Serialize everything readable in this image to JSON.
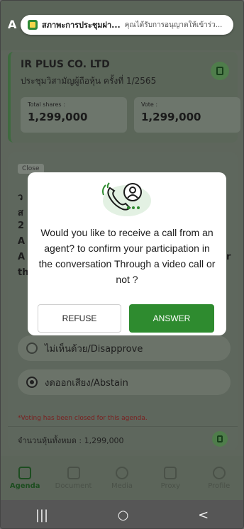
{
  "notification": {
    "title": "สภาพะการประชุมผ่า...",
    "message": "คุณได้รับการอนุญาตให้เข้าร่ว..."
  },
  "header": {
    "letter": "A"
  },
  "company": {
    "name": "IR PLUS CO. LTD",
    "meeting": "ประชุมวิสามัญผู้ถือหุ้น ครั้งที่ 1/2565",
    "total_shares_label": "Total shares :",
    "total_shares_value": "1,299,000",
    "vote_label": "Vote :",
    "vote_value": "1,299,000"
  },
  "agenda": {
    "status": "Close",
    "bg_lines": [
      "ว",
      "ส",
      "2",
      "A",
      "A",
      "th"
    ],
    "bg_right": "r",
    "options": [
      {
        "label": "ไม่เห็นด้วย/Disapprove",
        "selected": false
      },
      {
        "label": "งดออกเสียง/Abstain",
        "selected": true
      }
    ],
    "closed_note": "*Voting has been closed for this agenda.",
    "total_text": "จำนวนหุ้นทั้งหมด : 1,299,000"
  },
  "dialog": {
    "message": "Would you like to receive a call from an agent? to confirm your participation in the conversation Through a video call or not ?",
    "refuse_label": "REFUSE",
    "answer_label": "ANSWER"
  },
  "nav": [
    {
      "label": "Agenda",
      "icon": "agenda-icon",
      "active": true
    },
    {
      "label": "Document",
      "icon": "document-icon",
      "active": false
    },
    {
      "label": "Media",
      "icon": "media-icon",
      "active": false
    },
    {
      "label": "Proxy",
      "icon": "proxy-icon",
      "active": false
    },
    {
      "label": "Profile",
      "icon": "profile-icon",
      "active": false
    }
  ],
  "system_nav": {
    "recents": "|||",
    "home": "○",
    "back": "<"
  },
  "colors": {
    "accent": "#2e8b2f",
    "scrim": "#5e665c"
  }
}
